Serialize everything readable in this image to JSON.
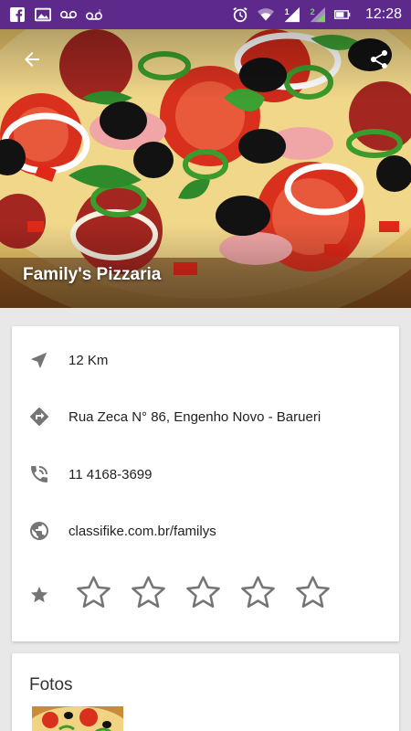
{
  "status_bar": {
    "time": "12:28",
    "left_icons": [
      "facebook-icon",
      "image-icon",
      "voicemail-icon",
      "voicemail-2-icon"
    ],
    "right_icons": [
      "alarm-icon",
      "wifi-icon",
      "signal-1-icon",
      "signal-2-icon",
      "battery-icon"
    ],
    "sim1_label": "1",
    "sim2_label": "2"
  },
  "header": {
    "title": "Family's Pizzaria",
    "back_icon": "arrow-back-icon",
    "share_icon": "share-icon"
  },
  "details": {
    "distance": "12 Km",
    "address": "Rua Zeca N° 86, Engenho Novo - Barueri",
    "phone": "11 4168-3699",
    "website": "classifike.com.br/familys",
    "rating_value": 0,
    "rating_max": 5
  },
  "photos": {
    "title": "Fotos"
  },
  "colors": {
    "status_bar": "#5d2a8c",
    "icon_grey": "#757575",
    "background": "#e8e8e8"
  }
}
